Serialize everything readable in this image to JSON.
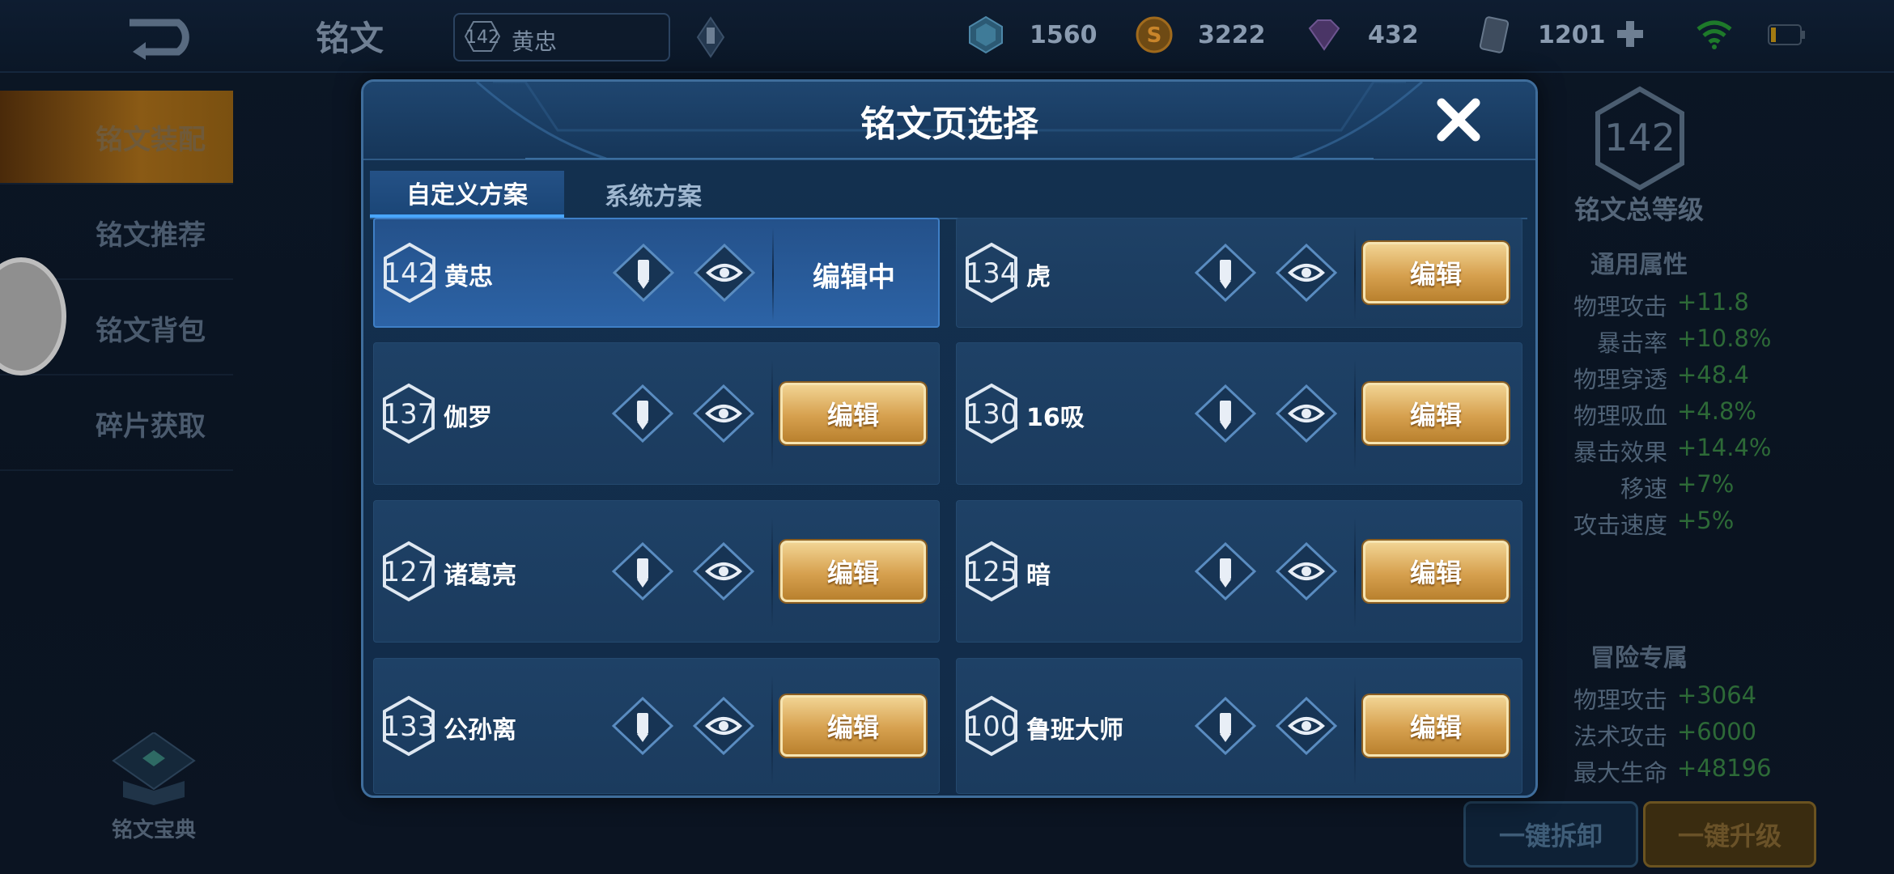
{
  "topbar": {
    "title": "铭文",
    "hero": {
      "level": "142",
      "name": "黄忠"
    },
    "resources": [
      {
        "icon": "crystal-icon",
        "value": "1560"
      },
      {
        "icon": "gold-coin-icon",
        "value": "3222"
      },
      {
        "icon": "gem-icon",
        "value": "432"
      },
      {
        "icon": "card-icon",
        "value": "1201"
      }
    ]
  },
  "leftmenu": {
    "items": [
      {
        "label": "铭文装配",
        "active": true
      },
      {
        "label": "铭文推荐",
        "active": false
      },
      {
        "label": "铭文背包",
        "active": false
      },
      {
        "label": "碎片获取",
        "active": false
      }
    ],
    "codex_label": "铭文宝典"
  },
  "rightpanel": {
    "total_level": "142",
    "total_label": "铭文总等级",
    "common_title": "通用属性",
    "common_attrs": [
      {
        "k": "物理攻击",
        "v": "+11.8"
      },
      {
        "k": "暴击率",
        "v": "+10.8%"
      },
      {
        "k": "物理穿透",
        "v": "+48.4"
      },
      {
        "k": "物理吸血",
        "v": "+4.8%"
      },
      {
        "k": "暴击效果",
        "v": "+14.4%"
      },
      {
        "k": "移速",
        "v": "+7%"
      },
      {
        "k": "攻击速度",
        "v": "+5%"
      }
    ],
    "adv_title": "冒险专属",
    "adv_attrs": [
      {
        "k": "物理攻击",
        "v": "+3064"
      },
      {
        "k": "法术攻击",
        "v": "+6000"
      },
      {
        "k": "最大生命",
        "v": "+48196"
      }
    ],
    "btn_unload": "一键拆卸",
    "btn_upgrade": "一键升级"
  },
  "modal": {
    "title": "铭文页选择",
    "tabs": [
      {
        "label": "自定义方案",
        "active": true
      },
      {
        "label": "系统方案",
        "active": false
      }
    ],
    "pages": [
      {
        "level": "142",
        "name": "黄忠",
        "status": "编辑中",
        "active": true
      },
      {
        "level": "134",
        "name": "虎",
        "status": "编辑",
        "active": false
      },
      {
        "level": "137",
        "name": "伽罗",
        "status": "编辑",
        "active": false
      },
      {
        "level": "130",
        "name": "16吸",
        "status": "编辑",
        "active": false
      },
      {
        "level": "127",
        "name": "诸葛亮",
        "status": "编辑",
        "active": false
      },
      {
        "level": "125",
        "name": "暗",
        "status": "编辑",
        "active": false
      },
      {
        "level": "133",
        "name": "公孙离",
        "status": "编辑",
        "active": false
      },
      {
        "level": "100",
        "name": "鲁班大师",
        "status": "编辑",
        "active": false
      }
    ]
  },
  "colors": {
    "gold_button": "#d6a04e",
    "panel_blue": "#1b3b5e",
    "active_blue": "#2c63a6",
    "attr_green": "#2d6a37"
  }
}
